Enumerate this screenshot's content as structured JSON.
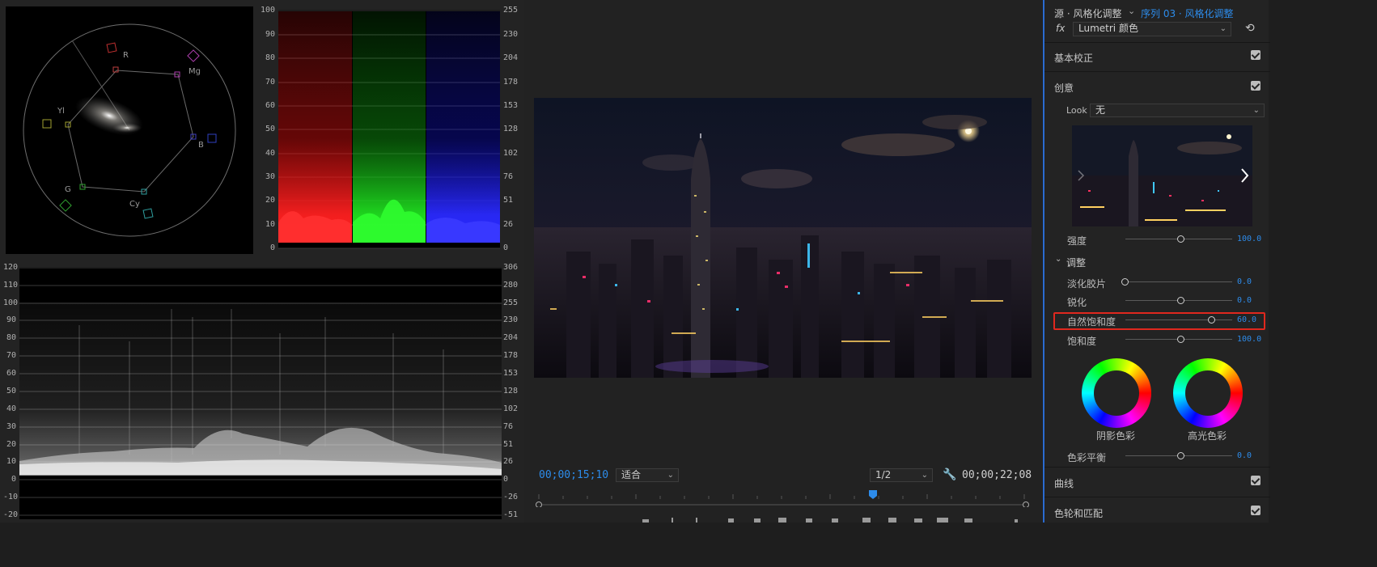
{
  "vectorscope": {
    "labels": [
      "R",
      "Mg",
      "B",
      "Cy",
      "G",
      "Yl"
    ]
  },
  "parade": {
    "left_ticks": [
      "100",
      "90",
      "80",
      "70",
      "60",
      "50",
      "40",
      "30",
      "20",
      "10",
      "0"
    ],
    "right_ticks": [
      "255",
      "230",
      "204",
      "178",
      "153",
      "128",
      "102",
      "76",
      "51",
      "26",
      "0"
    ]
  },
  "waveform": {
    "left_ticks": [
      "120",
      "110",
      "100",
      "90",
      "80",
      "70",
      "60",
      "50",
      "40",
      "30",
      "20",
      "10",
      "0",
      "-10",
      "-20"
    ],
    "right_ticks": [
      "306",
      "280",
      "255",
      "230",
      "204",
      "178",
      "153",
      "128",
      "102",
      "76",
      "51",
      "26",
      "0",
      "-26",
      "-51"
    ]
  },
  "monitor": {
    "timecode_current": "00;00;15;10",
    "fit_label": "适合",
    "resolution_label": "1/2",
    "timecode_duration": "00;00;22;08"
  },
  "lumetri": {
    "source_label": "源 · 风格化调整",
    "sequence_label": "序列 03 · 风格化调整",
    "fx_label": "fx",
    "effect_name": "Lumetri 颜色",
    "sections": {
      "basic": "基本校正",
      "creative": "创意",
      "curves": "曲线",
      "wheels": "色轮和匹配"
    },
    "look_label": "Look",
    "look_value": "无",
    "intensity": {
      "label": "强度",
      "value": "100.0"
    },
    "adjust_label": "调整",
    "sliders": [
      {
        "label": "淡化胶片",
        "value": "0.0"
      },
      {
        "label": "锐化",
        "value": "0.0"
      },
      {
        "label": "自然饱和度",
        "value": "60.0"
      },
      {
        "label": "饱和度",
        "value": "100.0"
      }
    ],
    "shadow_tint": "阴影色彩",
    "highlight_tint": "高光色彩",
    "color_balance": {
      "label": "色彩平衡",
      "value": "0.0"
    },
    "highlight_color": "#e0281e",
    "accent_color": "#2d8ceb"
  }
}
